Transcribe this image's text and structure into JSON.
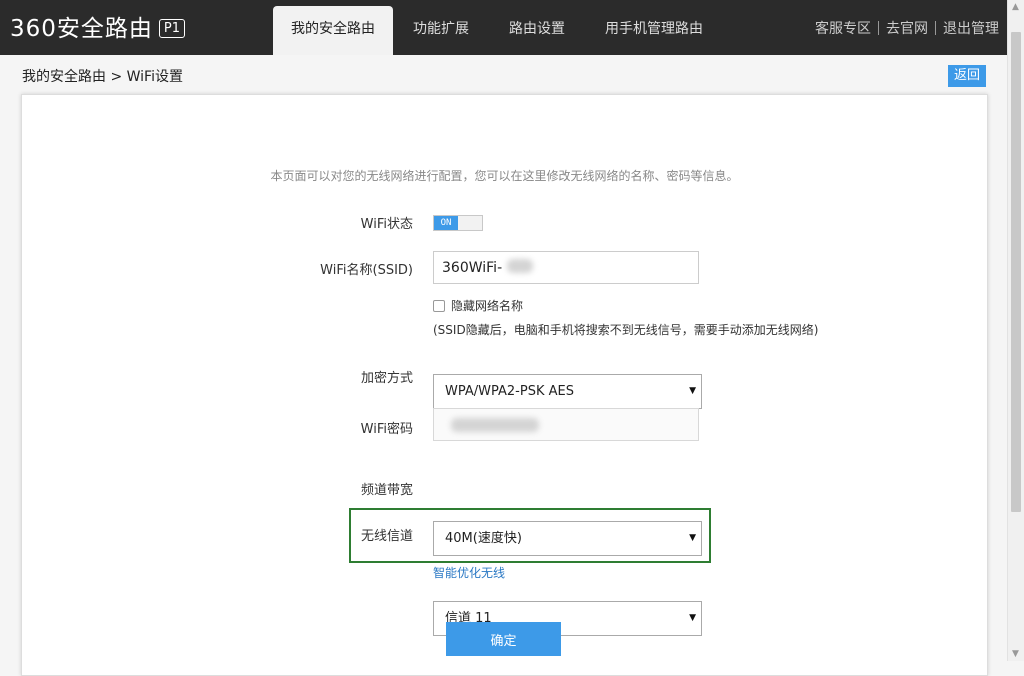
{
  "header": {
    "logo_text": "360安全路由",
    "logo_badge": "P1",
    "tabs": [
      {
        "label": "我的安全路由",
        "active": true
      },
      {
        "label": "功能扩展"
      },
      {
        "label": "路由设置"
      },
      {
        "label": "用手机管理路由"
      }
    ],
    "links": [
      "客服专区",
      "去官网",
      "退出管理"
    ]
  },
  "breadcrumb": "我的安全路由 > WiFi设置",
  "back_label": "返回",
  "form": {
    "intro": "本页面可以对您的无线网络进行配置，您可以在这里修改无线网络的名称、密码等信息。",
    "wifi_status_label": "WiFi状态",
    "wifi_status_value": "ON",
    "ssid_label": "WiFi名称(SSID)",
    "ssid_value": "360WiFi-",
    "hide_ssid_label": "隐藏网络名称",
    "hide_ssid_hint": "(SSID隐藏后，电脑和手机将搜索不到无线信号，需要手动添加无线网络)",
    "encryption_label": "加密方式",
    "encryption_value": "WPA/WPA2-PSK AES",
    "password_label": "WiFi密码",
    "bandwidth_label": "频道带宽",
    "bandwidth_value": "40M(速度快)",
    "channel_label": "无线信道",
    "channel_value": "信道 11",
    "smart_link": "智能优化无线",
    "submit_label": "确定"
  },
  "colors": {
    "accent": "#3d9ae8",
    "topbar": "#2b2b2b",
    "highlight_box": "#2e7d32",
    "link": "#2a78c4"
  }
}
